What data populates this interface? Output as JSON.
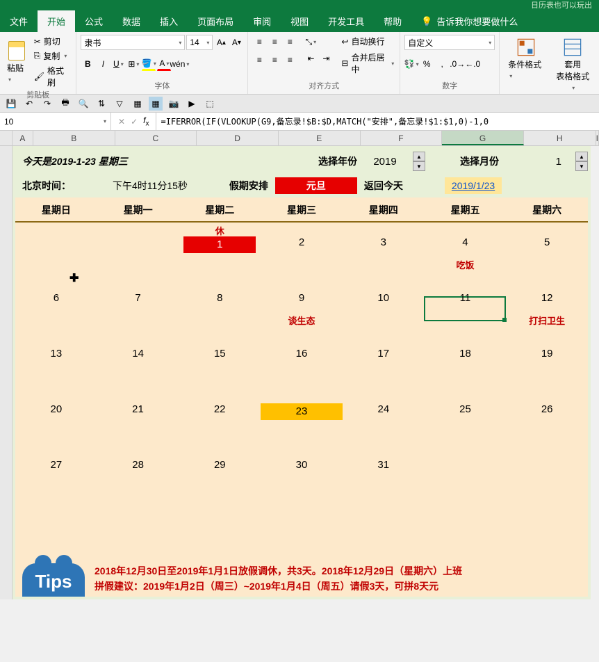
{
  "titlebar": "日历表也可以玩出",
  "tabs": [
    "文件",
    "开始",
    "公式",
    "数据",
    "插入",
    "页面布局",
    "审阅",
    "视图",
    "开发工具",
    "帮助"
  ],
  "tell_me": "告诉我你想要做什么",
  "clipboard": {
    "paste": "粘贴",
    "cut": "剪切",
    "copy": "复制",
    "painter": "格式刷",
    "label": "剪贴板"
  },
  "font": {
    "name": "隶书",
    "size": "14",
    "label": "字体"
  },
  "align": {
    "wrap": "自动换行",
    "merge": "合并后居中",
    "label": "对齐方式"
  },
  "number": {
    "format": "自定义",
    "label": "数字"
  },
  "styles": {
    "cond": "条件格式",
    "table": "套用\n表格格式"
  },
  "namebox": "10",
  "formula": "=IFERROR(IF(VLOOKUP(G9,备忘录!$B:$D,MATCH(\"安排\",备忘录!$1:$1,0)-1,0",
  "cols": [
    "A",
    "B",
    "C",
    "D",
    "E",
    "F",
    "G",
    "H",
    "I"
  ],
  "cal": {
    "today": "今天是2019-1-23 星期三",
    "year_label": "选择年份",
    "year": "2019",
    "month_label": "选择月份",
    "month": "1",
    "time_label": "北京时间：",
    "time": "下午4时11分15秒",
    "holiday_label": "假期安排",
    "holiday": "元旦",
    "return_label": "返回今天",
    "return_link": "2019/1/23",
    "weekdays": [
      "星期日",
      "星期一",
      "星期二",
      "星期三",
      "星期四",
      "星期五",
      "星期六"
    ],
    "rest": "休",
    "notes": {
      "c4": "吃饭",
      "c9": "谈生态",
      "c12": "打扫卫生"
    },
    "weeks": [
      [
        "",
        "",
        "1",
        "2",
        "3",
        "4",
        "5"
      ],
      [
        "6",
        "7",
        "8",
        "9",
        "10",
        "11",
        "12"
      ],
      [
        "13",
        "14",
        "15",
        "16",
        "17",
        "18",
        "19"
      ],
      [
        "20",
        "21",
        "22",
        "23",
        "24",
        "25",
        "26"
      ],
      [
        "27",
        "28",
        "29",
        "30",
        "31",
        "",
        ""
      ],
      [
        "",
        "",
        "",
        "",
        "",
        "",
        ""
      ]
    ]
  },
  "tips": {
    "badge": "Tips",
    "line1": "2018年12月30日至2019年1月1日放假调休，共3天。2018年12月29日（星期六）上班",
    "line2": "拼假建议：2019年1月2日（周三）~2019年1月4日（周五）请假3天，可拼8天元"
  }
}
